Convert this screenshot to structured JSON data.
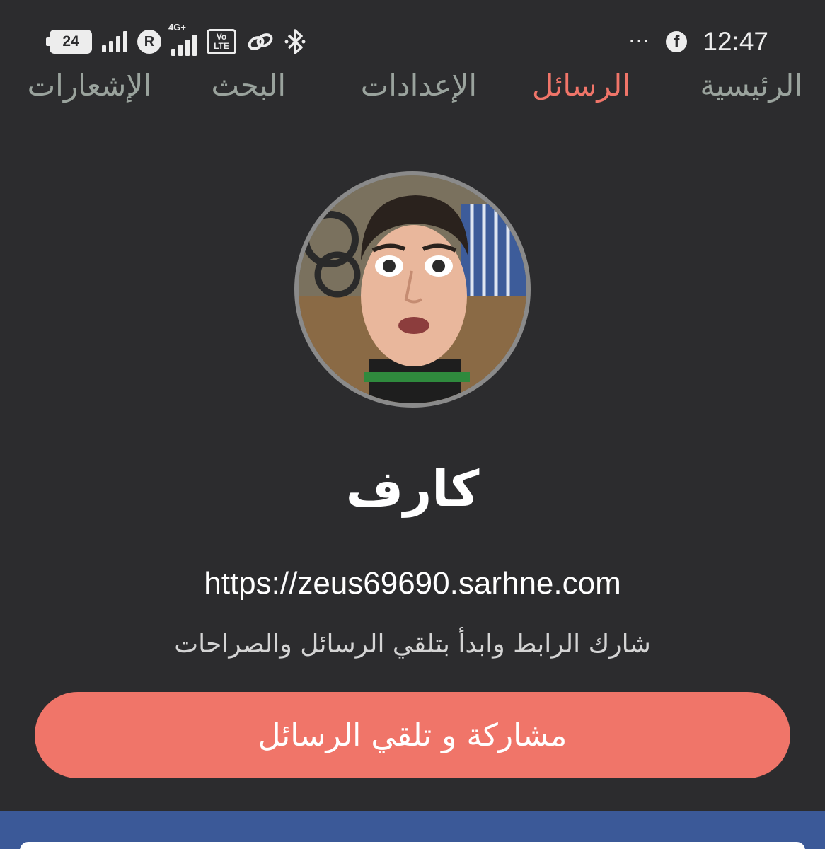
{
  "status_bar": {
    "battery_level": "24",
    "roaming_label": "R",
    "network_type": "4G+",
    "volte_label": "Vo\nLTE",
    "more_indicator": "···",
    "app_icon_letter": "f",
    "time": "12:47",
    "icons": [
      "battery-icon",
      "signal-icon",
      "roaming-icon",
      "network-4g-icon",
      "volte-icon",
      "link-icon",
      "bluetooth-icon",
      "more-icon",
      "facebook-icon"
    ]
  },
  "nav": {
    "tabs": [
      {
        "label": "الرئيسية",
        "active": false
      },
      {
        "label": "الرسائل",
        "active": true
      },
      {
        "label": "الإعدادات",
        "active": false
      },
      {
        "label": "البحث",
        "active": false
      },
      {
        "label": "الإشعارات",
        "active": false
      }
    ]
  },
  "profile": {
    "name": "كارف",
    "link": "https://zeus69690.sarhne.com",
    "hint": "شارك الرابط وابدأ بتلقي الرسائل والصراحات",
    "share_button_label": "مشاركة و تلقي الرسائل"
  },
  "colors": {
    "background": "#2c2c2e",
    "accent": "#f07569",
    "tab_inactive": "#9aa39d",
    "facebook_blue": "#3b5998"
  }
}
